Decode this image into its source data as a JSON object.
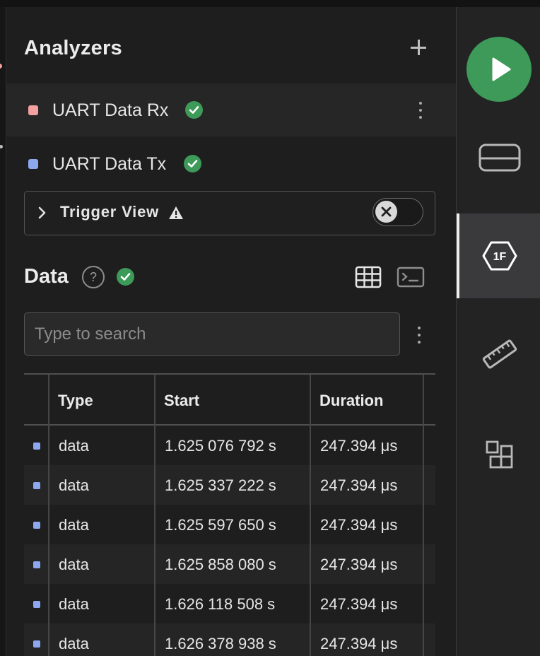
{
  "analyzers": {
    "title": "Analyzers",
    "items": [
      {
        "label": "UART Data Rx",
        "color": "#f2a0a0",
        "status": "ok"
      },
      {
        "label": "UART Data Tx",
        "color": "#8ea8f0",
        "status": "ok"
      }
    ]
  },
  "trigger_view": {
    "label": "Trigger View",
    "warning": true,
    "toggle_on": false
  },
  "data_section": {
    "title": "Data",
    "help_symbol": "?",
    "search_placeholder": "Type to search",
    "search_value": ""
  },
  "table": {
    "columns": [
      "Type",
      "Start",
      "Duration"
    ],
    "rows": [
      {
        "type": "data",
        "start": "1.625 076 792 s",
        "duration": "247.394 μs"
      },
      {
        "type": "data",
        "start": "1.625 337 222 s",
        "duration": "247.394 μs"
      },
      {
        "type": "data",
        "start": "1.625 597 650 s",
        "duration": "247.394 μs"
      },
      {
        "type": "data",
        "start": "1.625 858 080 s",
        "duration": "247.394 μs"
      },
      {
        "type": "data",
        "start": "1.626 118 508 s",
        "duration": "247.394 μs"
      },
      {
        "type": "data",
        "start": "1.626 378 938 s",
        "duration": "247.394 μs"
      }
    ]
  },
  "rightbar": {
    "items": [
      {
        "name": "device-icon"
      },
      {
        "name": "analyzers-1f-icon",
        "active": true
      },
      {
        "name": "ruler-icon"
      },
      {
        "name": "extensions-icon"
      }
    ],
    "hex_icon_text": "1F"
  },
  "colors": {
    "accent_green": "#3d9a58",
    "tx_marker": "#8ea8f0",
    "rx_marker": "#f2a0a0"
  }
}
